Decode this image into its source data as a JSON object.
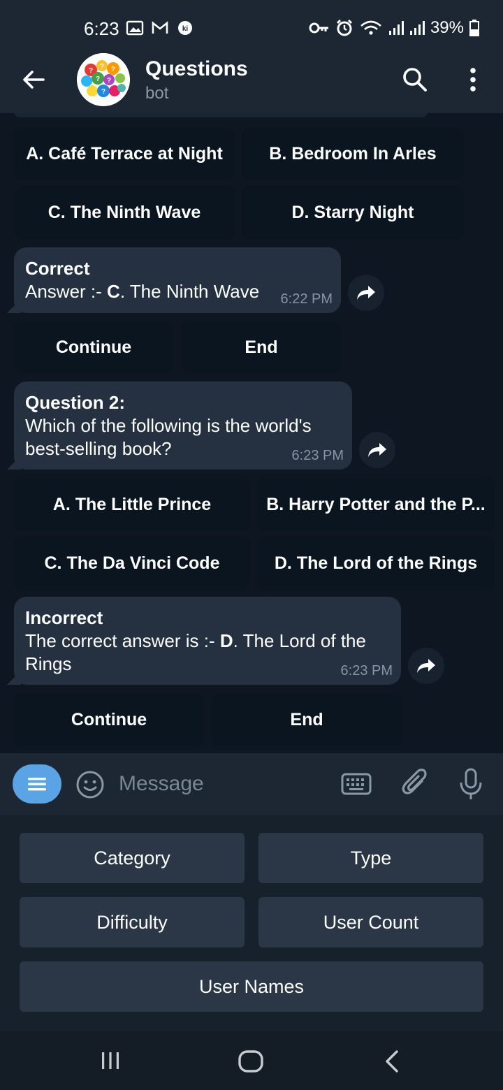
{
  "status_bar": {
    "time": "6:23",
    "battery": "39%"
  },
  "header": {
    "title": "Questions",
    "subtitle": "bot"
  },
  "messages": {
    "q1_options": [
      "A. Café Terrace at Night",
      "B. Bedroom In Arles",
      "C. The Ninth Wave",
      "D. Starry Night"
    ],
    "result1": {
      "status": "Correct",
      "answer_prefix": "Answer :- ",
      "answer_letter": "C",
      "answer_rest": ". The Ninth Wave",
      "time": "6:22 PM"
    },
    "actions1": [
      "Continue",
      "End"
    ],
    "question2": {
      "heading": "Question 2:",
      "line1": "Which of the following is the world's",
      "line2": "best-selling book?",
      "time": "6:23 PM"
    },
    "q2_options": [
      "A. The Little Prince",
      "B. Harry Potter and the P...",
      "C. The Da Vinci Code",
      "D. The Lord of the Rings"
    ],
    "result2": {
      "status": "Incorrect",
      "answer_prefix": "The correct answer is :- ",
      "answer_letter": "D",
      "answer_rest": ". The Lord of the",
      "line2": "Rings",
      "time": "6:23 PM"
    },
    "actions2": [
      "Continue",
      "End"
    ]
  },
  "input": {
    "placeholder": "Message"
  },
  "reply_keyboard": {
    "category": "Category",
    "type": "Type",
    "difficulty": "Difficulty",
    "user_count": "User Count",
    "user_names": "User Names"
  },
  "colors": {
    "background": "#0e1621",
    "header": "#1c2733",
    "bubble": "#253140",
    "accent": "#5aa3e5"
  }
}
